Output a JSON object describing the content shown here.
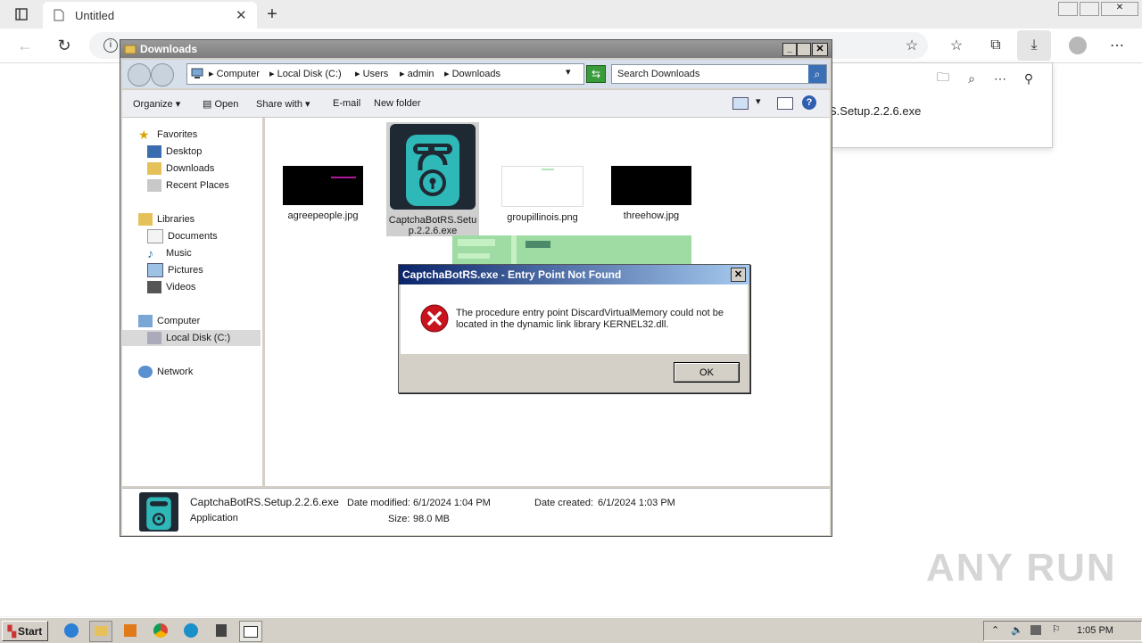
{
  "browser": {
    "tab_title": "Untitled",
    "new_tab_symbol": "+",
    "download_item_text": "S.Setup.2.2.6.exe"
  },
  "explorer": {
    "title": "Downloads",
    "breadcrumb": [
      "Computer",
      "Local Disk (C:)",
      "Users",
      "admin",
      "Downloads"
    ],
    "search_placeholder": "Search Downloads",
    "commands": [
      "Organize",
      "Open",
      "Share with",
      "E-mail",
      "New folder"
    ],
    "nav": {
      "favorites": "Favorites",
      "desktop": "Desktop",
      "downloads": "Downloads",
      "recent": "Recent Places",
      "libraries": "Libraries",
      "documents": "Documents",
      "music": "Music",
      "pictures": "Pictures",
      "videos": "Videos",
      "computer": "Computer",
      "local_disk": "Local Disk (C:)",
      "network": "Network"
    },
    "files": [
      {
        "name": "agreepeople.jpg"
      },
      {
        "name": "CaptchaBotRS.Setup.2.2.6.exe",
        "name_line1": "CaptchaBotRS.Setu",
        "name_line2": "p.2.2.6.exe"
      },
      {
        "name": "groupillinois.png"
      },
      {
        "name": "threehow.jpg"
      }
    ],
    "details": {
      "filename": "CaptchaBotRS.Setup.2.2.6.exe",
      "type": "Application",
      "modified_label": "Date modified:",
      "modified_value": "6/1/2024 1:04 PM",
      "created_label": "Date created:",
      "created_value": "6/1/2024 1:03 PM",
      "size_label": "Size:",
      "size_value": "98.0 MB"
    }
  },
  "dialog": {
    "title": "CaptchaBotRS.exe - Entry Point Not Found",
    "message_line1": "The procedure entry point DiscardVirtualMemory could not be",
    "message_line2": "located in the dynamic link library KERNEL32.dll.",
    "ok_label": "OK"
  },
  "taskbar": {
    "start_label": "Start",
    "clock": "1:05 PM"
  },
  "watermark": "ANY RUN",
  "colors": {
    "app_icon_bg": "#1f2933",
    "app_icon_teal": "#2fb8b8",
    "error_red": "#c8141e",
    "title_blue": "#0a246a"
  }
}
